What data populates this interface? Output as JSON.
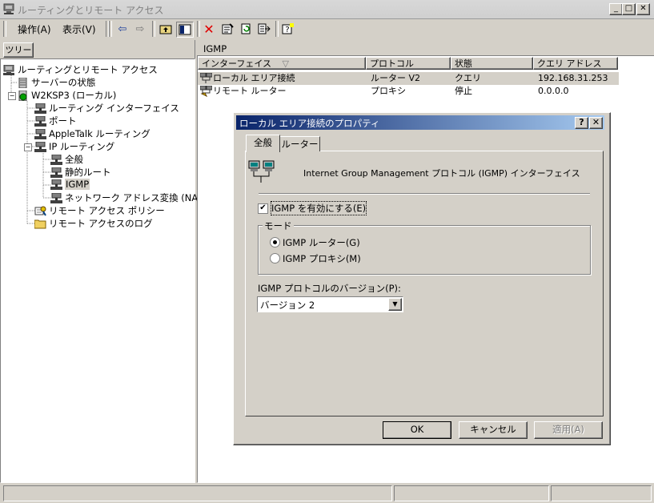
{
  "window": {
    "title": "ルーティングとリモート アクセス",
    "minimize": "_",
    "maximize": "□",
    "close": "✕"
  },
  "menu": {
    "action": "操作(A)",
    "view": "表示(V)"
  },
  "left_pane": {
    "tab_label": "ツリー",
    "tree": [
      {
        "label": "ルーティングとリモート アクセス",
        "icon": "computer-icon"
      },
      {
        "label": "サーバーの状態",
        "icon": "server-icon"
      },
      {
        "label": "W2KSP3 (ローカル)",
        "icon": "server-status-icon"
      },
      {
        "label": "ルーティング インターフェイス",
        "icon": "network-icon"
      },
      {
        "label": "ポート",
        "icon": "network-icon"
      },
      {
        "label": "AppleTalk ルーティング",
        "icon": "network-icon"
      },
      {
        "label": "IP ルーティング",
        "icon": "network-icon"
      },
      {
        "label": "全般",
        "icon": "network-icon"
      },
      {
        "label": "静的ルート",
        "icon": "network-icon"
      },
      {
        "label": "IGMP",
        "icon": "network-icon"
      },
      {
        "label": "ネットワーク アドレス変換 (NAT)",
        "icon": "network-icon"
      },
      {
        "label": "リモート アクセス ポリシー",
        "icon": "policy-icon"
      },
      {
        "label": "リモート アクセスのログ",
        "icon": "folder-icon"
      }
    ]
  },
  "right_pane": {
    "header": "IGMP",
    "columns": [
      "インターフェイス",
      "プロトコル",
      "状態",
      "クエリ アドレス"
    ],
    "sort_indicator": "▽",
    "rows": [
      {
        "interface": "ローカル エリア接続",
        "protocol": "ルーター V2",
        "state": "クエリ",
        "query": "192.168.31.253"
      },
      {
        "interface": "リモート ルーター",
        "protocol": "プロキシ",
        "state": "停止",
        "query": "0.0.0.0"
      }
    ]
  },
  "dialog": {
    "title": "ローカル エリア接続のプロパティ",
    "help": "?",
    "close": "✕",
    "tabs": [
      "全般",
      "ルーター"
    ],
    "description": "Internet Group Management プロトコル (IGMP) インターフェイス",
    "enable_label": "IGMP を有効にする(E)",
    "enable_checked": true,
    "mode_group": "モード",
    "mode_options": [
      "IGMP ルーター(G)",
      "IGMP プロキシ(M)"
    ],
    "mode_selected": 0,
    "version_label": "IGMP プロトコルのバージョン(P):",
    "version_value": "バージョン 2",
    "buttons": {
      "ok": "OK",
      "cancel": "キャンセル",
      "apply": "適用(A)"
    }
  }
}
